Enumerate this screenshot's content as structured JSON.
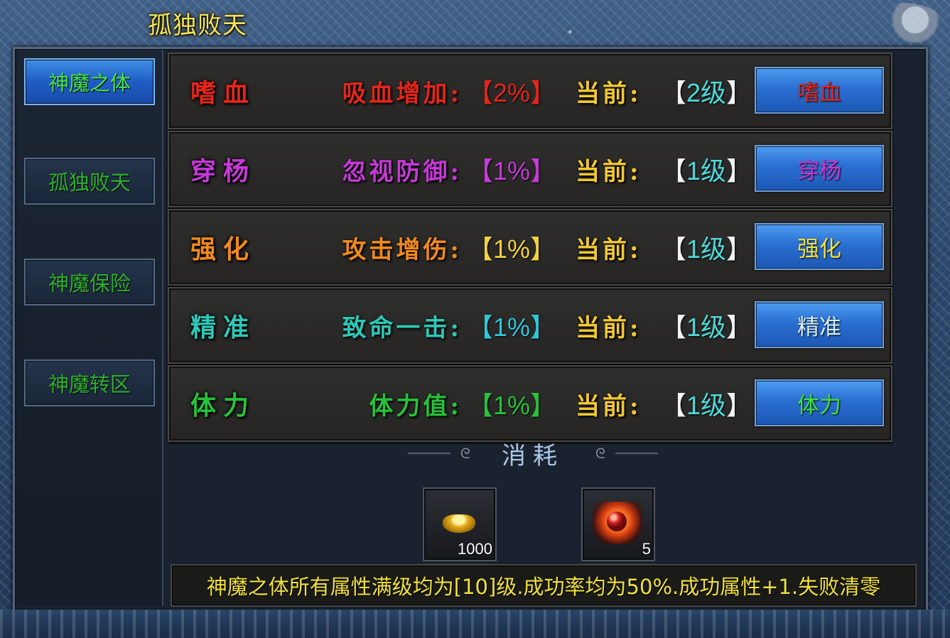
{
  "window": {
    "title": "孤独败天"
  },
  "sidebar": {
    "items": [
      {
        "label": "神魔之体",
        "active": true
      },
      {
        "label": "孤独败天",
        "active": false
      },
      {
        "label": "神魔保险",
        "active": false
      },
      {
        "label": "神魔转区",
        "active": false
      }
    ]
  },
  "rows": [
    {
      "name": "嗜血",
      "name_color": "#e3261c",
      "attr_label": "吸血增加:",
      "attr_label_color": "#e3261c",
      "attr_value": "【2%】",
      "attr_value_color": "#e3261c",
      "current_label": "当前:",
      "current_open": "【",
      "current_value": "2级",
      "current_close": "】",
      "button_label": "嗜血",
      "button_color": "#e3261c"
    },
    {
      "name": "穿杨",
      "name_color": "#c63ad6",
      "attr_label": "忽视防御:",
      "attr_label_color": "#c63ad6",
      "attr_value": "【1%】",
      "attr_value_color": "#c63ad6",
      "current_label": "当前:",
      "current_open": "【",
      "current_value": "1级",
      "current_close": "】",
      "button_label": "穿杨",
      "button_color": "#c63ad6"
    },
    {
      "name": "强化",
      "name_color": "#f08a1e",
      "attr_label": "攻击增伤:",
      "attr_label_color": "#f08a1e",
      "attr_value": "【1%】",
      "attr_value_color": "#f2d040",
      "current_label": "当前:",
      "current_open": "【",
      "current_value": "1级",
      "current_close": "】",
      "button_label": "强化",
      "button_color": "#f0e040"
    },
    {
      "name": "精准",
      "name_color": "#2fc7b7",
      "attr_label": "致命一击:",
      "attr_label_color": "#2fc7b7",
      "attr_value": "【1%】",
      "attr_value_color": "#2fc7d7",
      "current_label": "当前:",
      "current_open": "【",
      "current_value": "1级",
      "current_close": "】",
      "button_label": "精准",
      "button_color": "#d8f0f8"
    },
    {
      "name": "体力",
      "name_color": "#27c23a",
      "attr_label": "体力值:",
      "attr_label_color": "#27c23a",
      "attr_value": "【1%】",
      "attr_value_color": "#27c23a",
      "current_label": "当前:",
      "current_open": "【",
      "current_value": "1级",
      "current_close": "】",
      "button_label": "体力",
      "button_color": "#40e040"
    }
  ],
  "consume": {
    "title": "消耗",
    "items": [
      {
        "icon": "gold-ingot-icon",
        "quantity": "1000"
      },
      {
        "icon": "fire-orb-icon",
        "quantity": "5"
      }
    ]
  },
  "info_text": "神魔之体所有属性满级均为[10]级.成功率均为50%.成功属性+1.失败清零",
  "colors": {
    "title": "#f4e45c",
    "current_label": "#f2c833",
    "current_value": "#4fd8d8",
    "info_text": "#f0e040",
    "active_tab": "#2a6fd2"
  }
}
